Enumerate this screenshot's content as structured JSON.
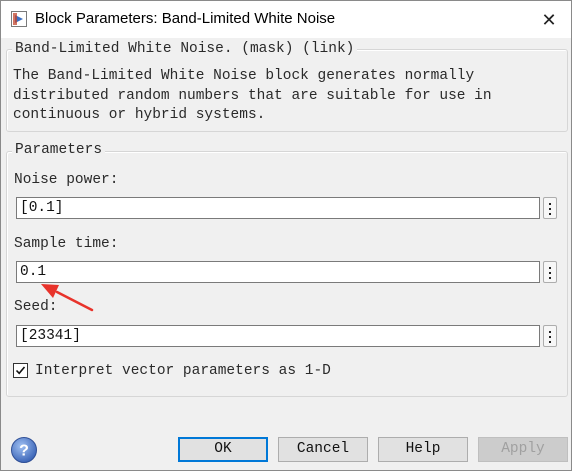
{
  "window": {
    "title": "Block Parameters: Band-Limited White Noise",
    "close_glyph": "✕"
  },
  "mask": {
    "legend": "Band-Limited White Noise. (mask) (link)",
    "description": "The Band-Limited White Noise block generates normally\ndistributed random numbers that are suitable for use in\ncontinuous or hybrid systems."
  },
  "parameters": {
    "legend": "Parameters",
    "noise_power": {
      "label": "Noise power:",
      "value": "[0.1]"
    },
    "sample_time": {
      "label": "Sample time:",
      "value": "0.1"
    },
    "seed": {
      "label": "Seed:",
      "value": "[23341]"
    },
    "interpret_vector": {
      "label": "Interpret vector parameters as 1-D",
      "checked": true
    }
  },
  "buttons": {
    "ok": "OK",
    "cancel": "Cancel",
    "help": "Help",
    "apply": "Apply"
  },
  "icons": {
    "help": "help-question-icon",
    "more_options": "vertical-ellipsis-icon",
    "annotation": "red-arrow-annotation"
  },
  "colors": {
    "accent": "#0078d7",
    "annotation_arrow": "#e8332b",
    "help_icon": "#4a78c8"
  }
}
